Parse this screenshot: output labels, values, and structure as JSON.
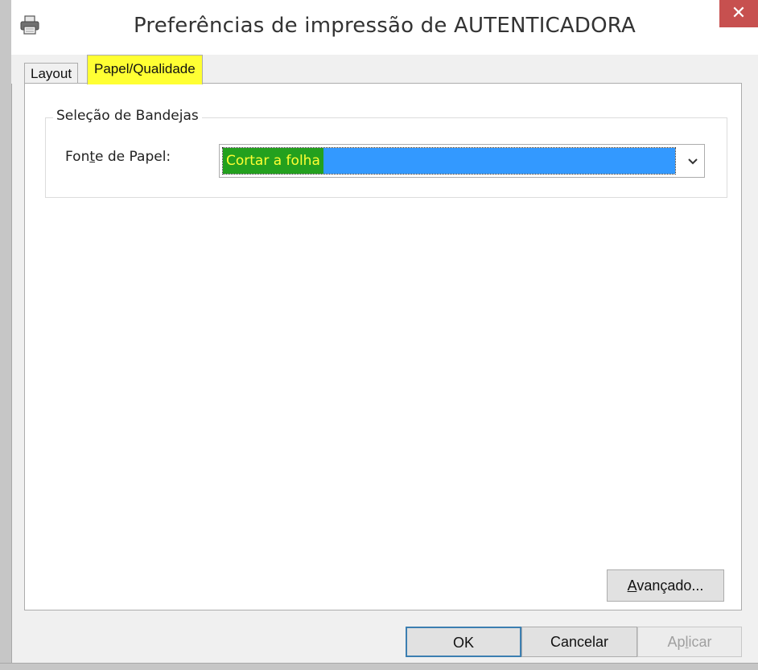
{
  "window": {
    "title": "Preferências de impressão de AUTENTICADORA",
    "close_glyph": "✕",
    "icon": "printer-icon"
  },
  "tabs": [
    {
      "label": "Layout",
      "active": false
    },
    {
      "label": "Papel/Qualidade",
      "active": true,
      "highlight": "#ffff33"
    }
  ],
  "tray_group": {
    "legend": "Seleção de Bandejas",
    "paper_source": {
      "label_pre": "Fon",
      "label_mnemonic": "t",
      "label_post": "e de Papel:",
      "selected_value": "Cortar a folha",
      "selection_color": "#3399ff"
    }
  },
  "buttons": {
    "advanced_mnemonic": "A",
    "advanced_rest": "vançado...",
    "ok": "OK",
    "cancel": "Cancelar",
    "apply_pre": "Ap",
    "apply_mnemonic": "l",
    "apply_post": "icar"
  }
}
